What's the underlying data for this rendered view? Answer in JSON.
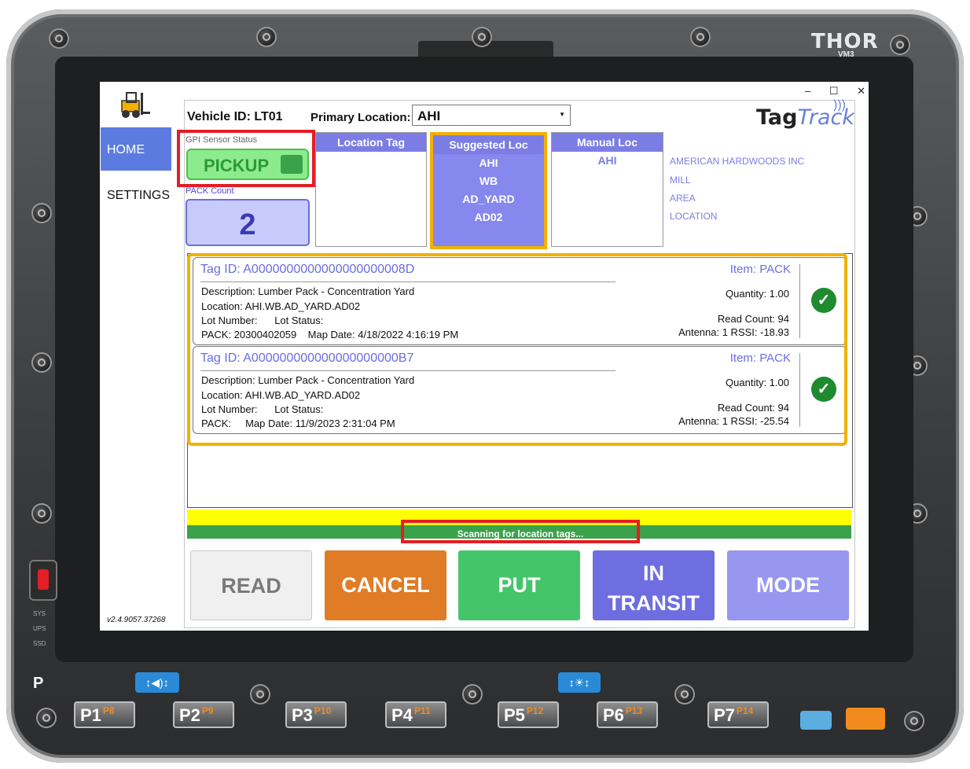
{
  "device": {
    "brand": "THOR",
    "model": "VM3",
    "p_label": "P",
    "leds": [
      "SYS",
      "UPS",
      "SSD"
    ],
    "keys": [
      {
        "label": "P1",
        "alt": "P8"
      },
      {
        "label": "P2",
        "alt": "P9"
      },
      {
        "label": "P3",
        "alt": "P10"
      },
      {
        "label": "P4",
        "alt": "P11"
      },
      {
        "label": "P5",
        "alt": "P12"
      },
      {
        "label": "P6",
        "alt": "P13"
      },
      {
        "label": "P7",
        "alt": "P14"
      }
    ]
  },
  "window": {
    "minimize": "–",
    "maximize": "☐",
    "close": "✕"
  },
  "nav": {
    "home": "HOME",
    "settings": "SETTINGS",
    "version": "v2.4.9057.37268"
  },
  "header": {
    "vehicle": "Vehicle ID: LT01",
    "primary_label": "Primary Location:",
    "primary_value": "AHI",
    "logo_part1": "Tag",
    "logo_part2": "Track"
  },
  "gpi": {
    "label": "GPI Sensor Status",
    "status": "PICKUP"
  },
  "pack": {
    "label": "PACK Count",
    "count": "2"
  },
  "columns": {
    "location_tag": {
      "title": "Location Tag"
    },
    "suggested": {
      "title": "Suggested Loc",
      "lines": [
        "AHI",
        "WB",
        "AD_YARD",
        "AD02"
      ]
    },
    "manual": {
      "title": "Manual Loc",
      "lines": [
        "AHI"
      ]
    }
  },
  "descriptions": [
    "AMERICAN HARDWOODS INC",
    "MILL",
    "AREA",
    "LOCATION"
  ],
  "tags": [
    {
      "tag_id": "Tag ID: A0000000000000000000008D",
      "description": "Description: Lumber Pack - Concentration Yard",
      "location": "Location: AHI.WB.AD_YARD.AD02",
      "lot": "Lot Number:      Lot Status:",
      "pack": "PACK: 20300402059    Map Date: 4/18/2022 4:16:19 PM",
      "item": "Item: PACK",
      "quantity": "Quantity: 1.00",
      "read_count": "Read Count: 94",
      "antenna": "Antenna: 1  RSSI: -18.93"
    },
    {
      "tag_id": "Tag ID: A000000000000000000000B7",
      "description": "Description: Lumber Pack - Concentration Yard",
      "location": "Location: AHI.WB.AD_YARD.AD02",
      "lot": "Lot Number:      Lot Status:",
      "pack": "PACK:     Map Date: 11/9/2023 2:31:04 PM",
      "item": "Item: PACK",
      "quantity": "Quantity: 1.00",
      "read_count": "Read Count: 94",
      "antenna": "Antenna: 1  RSSI: -25.54"
    }
  ],
  "status": "Scanning for location tags...",
  "buttons": {
    "read": "READ",
    "cancel": "CANCEL",
    "put": "PUT",
    "transit_line1": "IN",
    "transit_line2": "TRANSIT",
    "mode": "MODE"
  },
  "colors": {
    "accent": "#7b7de5",
    "highlight_red": "#e31e24",
    "highlight_yellow": "#f2b000",
    "status_green": "#3aa24a",
    "cancel_orange": "#e07c26"
  }
}
